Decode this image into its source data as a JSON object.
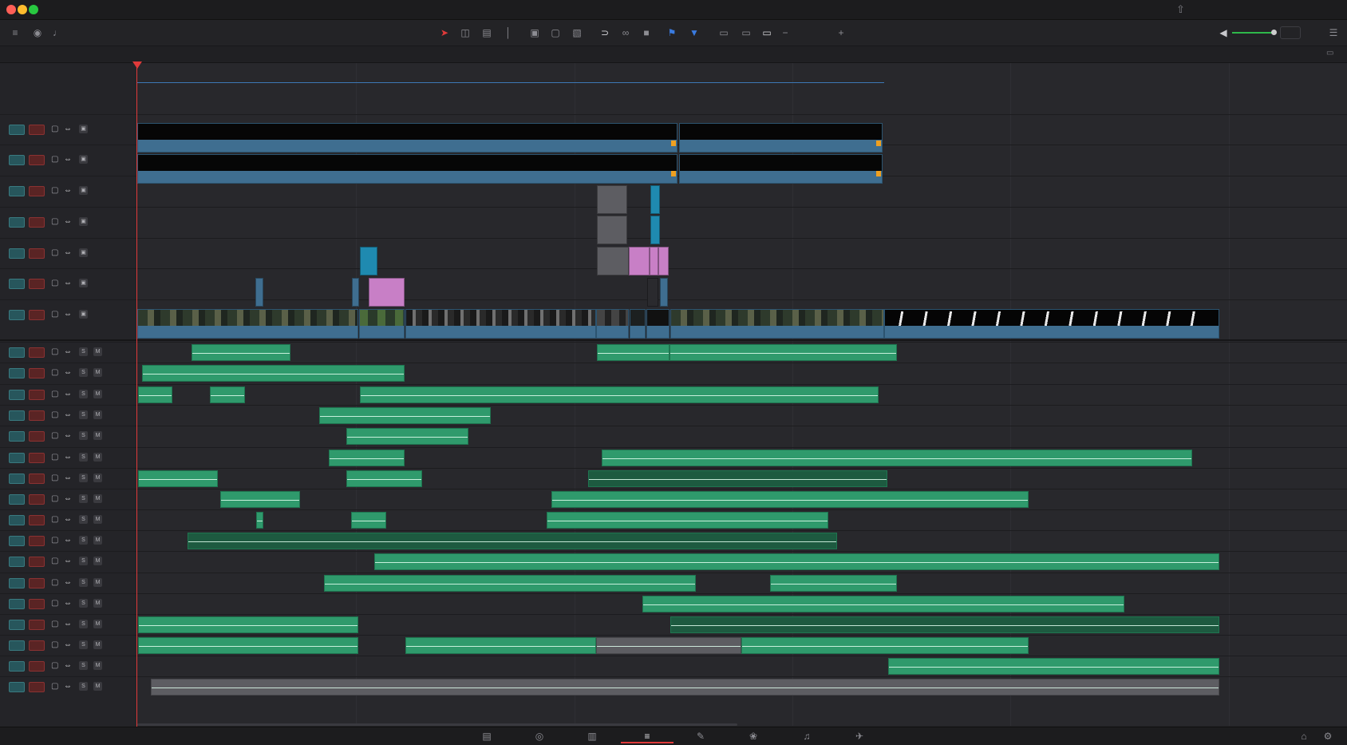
{
  "window": {
    "controls": [
      {
        "name": "close-button",
        "color": "#ff5f57"
      },
      {
        "name": "minimize-button",
        "color": "#febc2e"
      },
      {
        "name": "maximize-button",
        "color": "#28c840"
      }
    ]
  },
  "toolbar": {
    "left_tools": [
      "track-options-icon",
      "audio-track-icon",
      "mic-icon"
    ],
    "center_tools": [
      "selection-arrow-icon",
      "trim-edit-icon",
      "dynamic-trim-icon",
      "blade-icon",
      "insert-clip-icon",
      "overwrite-clip-icon",
      "replace-clip-icon",
      "snapping-icon",
      "linked-selection-icon",
      "position-lock-icon",
      "flag-icon",
      "marker-icon",
      "zoom-full-icon",
      "zoom-detail-icon",
      "zoom-custom-icon",
      "zoom-out-icon",
      "zoom-in-icon"
    ],
    "right_tools": [
      "volume-icon",
      "timeline-options-icon"
    ],
    "accent_color": "#e03a3a"
  },
  "tracks": {
    "video_count": 7,
    "audio_count": 17,
    "audio_solo_label": "S",
    "audio_mute_label": "M",
    "video_color": "#3f6e90",
    "audio_color": "#2f9a6c"
  },
  "page_tabs": [
    "media-page-icon",
    "cut-page-icon",
    "edit-page-icon",
    "fusion-page-icon",
    "color-page-icon",
    "fairlight-page-icon",
    "deliver-page-icon"
  ],
  "page_tabs_active": "edit-page-icon",
  "bottom_right": [
    "home-icon",
    "settings-icon"
  ]
}
